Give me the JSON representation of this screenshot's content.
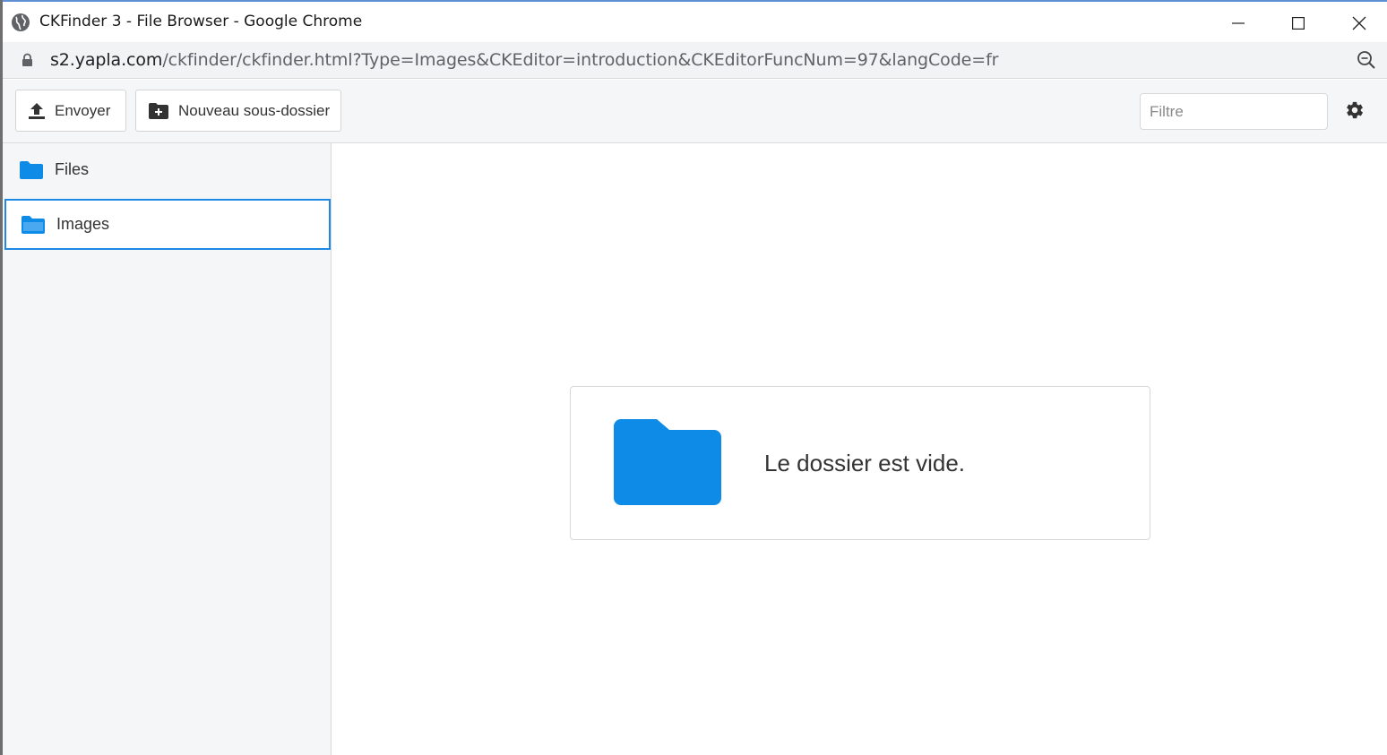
{
  "window": {
    "title": "CKFinder 3 - File Browser - Google Chrome",
    "url_host": "s2.yapla.com",
    "url_path": "/ckfinder/ckfinder.html?Type=Images&CKEditor=introduction&CKEditorFuncNum=97&langCode=fr"
  },
  "toolbar": {
    "upload_label": "Envoyer",
    "new_folder_label": "Nouveau sous-dossier",
    "filter_placeholder": "Filtre"
  },
  "sidebar": {
    "items": [
      {
        "label": "Files",
        "icon": "folder-icon",
        "selected": false
      },
      {
        "label": "Images",
        "icon": "folder-open-icon",
        "selected": true
      }
    ]
  },
  "main": {
    "empty_message": "Le dossier est vide."
  },
  "colors": {
    "accent": "#1e88e5",
    "folder": "#0e8ae7"
  }
}
